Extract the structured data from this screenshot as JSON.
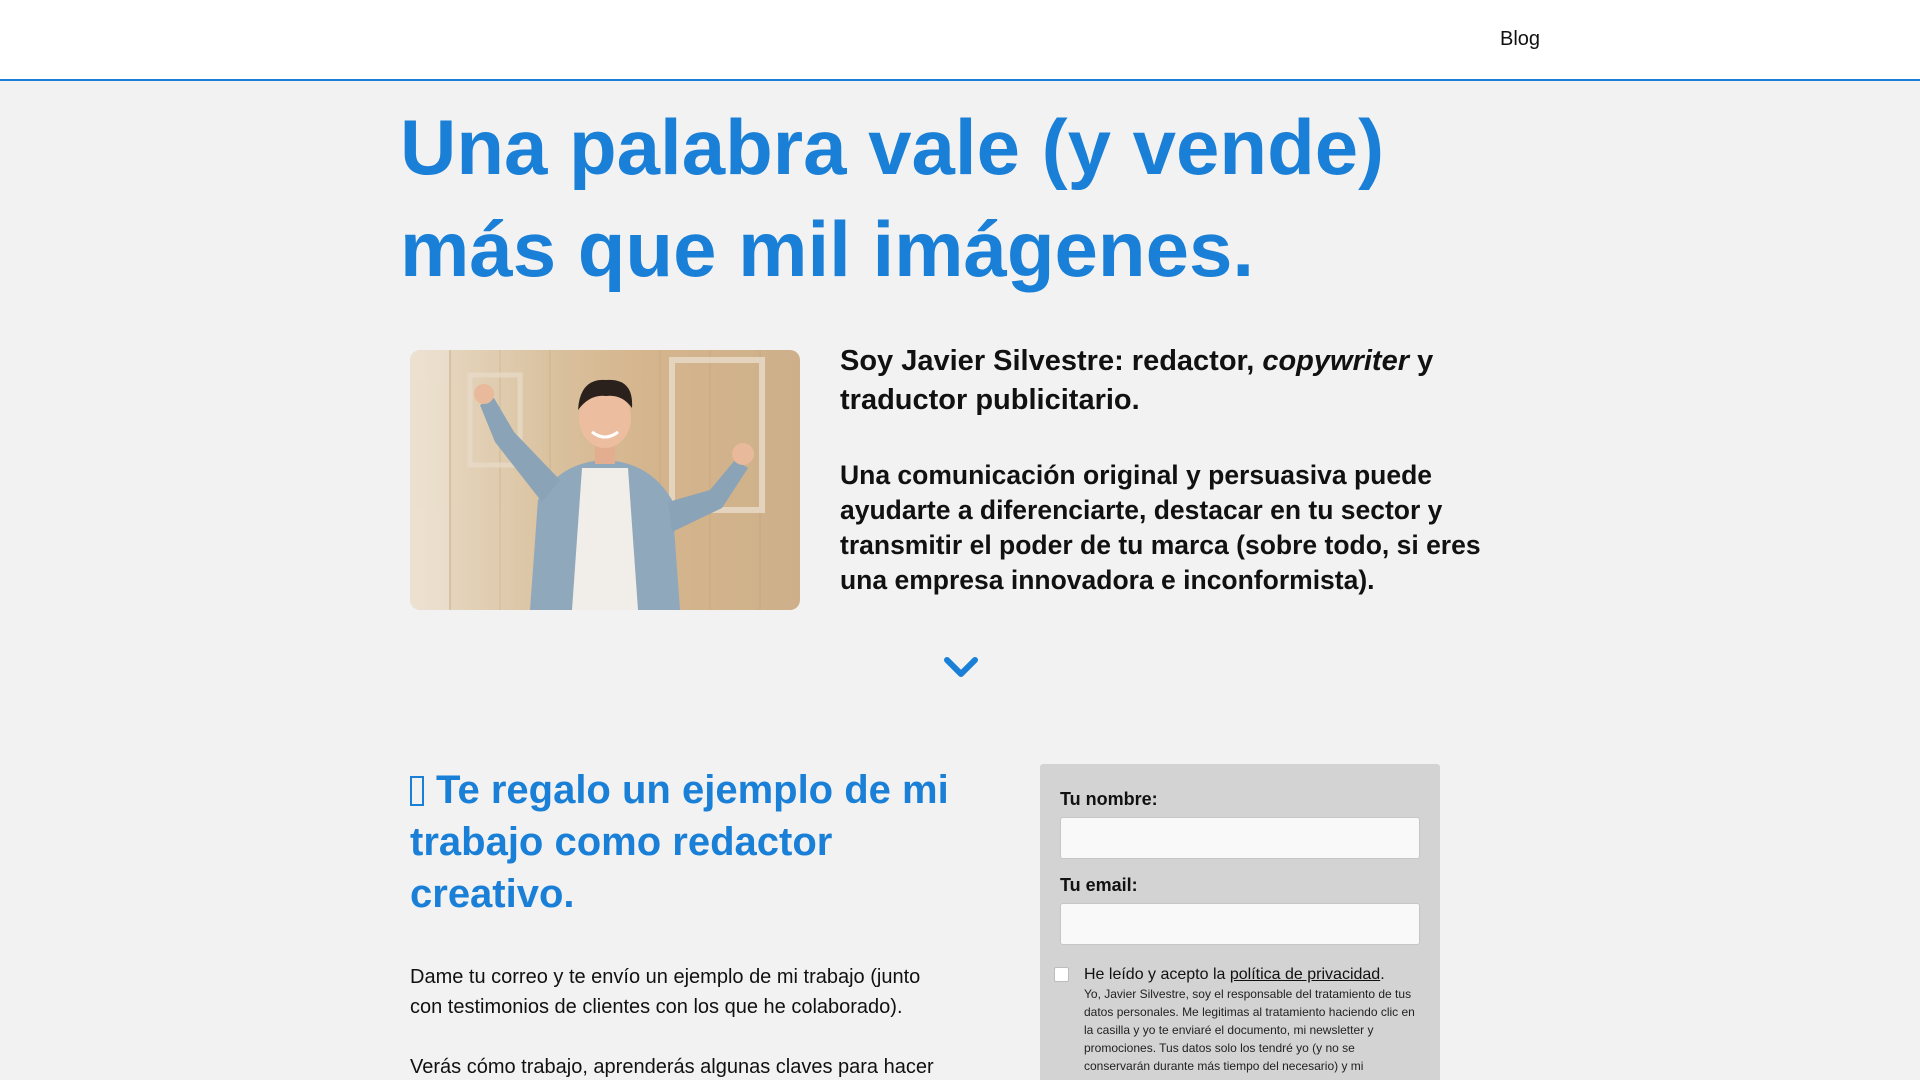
{
  "header": {
    "nav_blog": "Blog"
  },
  "hero": {
    "title": "Una palabra vale (y vende) más que mil imágenes."
  },
  "intro": {
    "p1_before": "Soy Javier Silvestre: redactor, ",
    "p1_italic": "copywriter",
    "p1_after": " y traductor publicitario.",
    "p2": "Una comunicación original y persuasiva puede ayudarte a diferenciarte, destacar en tu sector y transmitir el poder de tu marca (sobre todo, si eres una empresa innovadora e inconformista)."
  },
  "gift": {
    "title": "Te regalo un ejemplo de mi trabajo como redactor creativo.",
    "p1": "Dame tu correo y te envío un ejemplo de mi trabajo (junto con testimonios de clientes con los que he colaborado).",
    "p2": "Verás cómo trabajo, aprenderás algunas claves para hacer"
  },
  "form": {
    "name_label": "Tu nombre:",
    "email_label": "Tu email:",
    "consent_before": "He leído y acepto la ",
    "consent_link": "política de privacidad",
    "consent_after": ".",
    "consent_small": "Yo, Javier Silvestre, soy el responsable del tratamiento de tus datos personales. Me legitimas al tratamiento haciendo clic en la casilla y yo te enviaré el documento, mi newsletter y promociones. Tus datos solo los tendré yo (y no se conservarán durante más tiempo del necesario) y mi"
  },
  "icons": {
    "chevron": "chevron-down-icon",
    "gift": "missing-glyph-icon"
  },
  "colors": {
    "accent": "#1a7fd6",
    "background": "#f2f2f2",
    "form_bg": "#d3d3d3"
  }
}
